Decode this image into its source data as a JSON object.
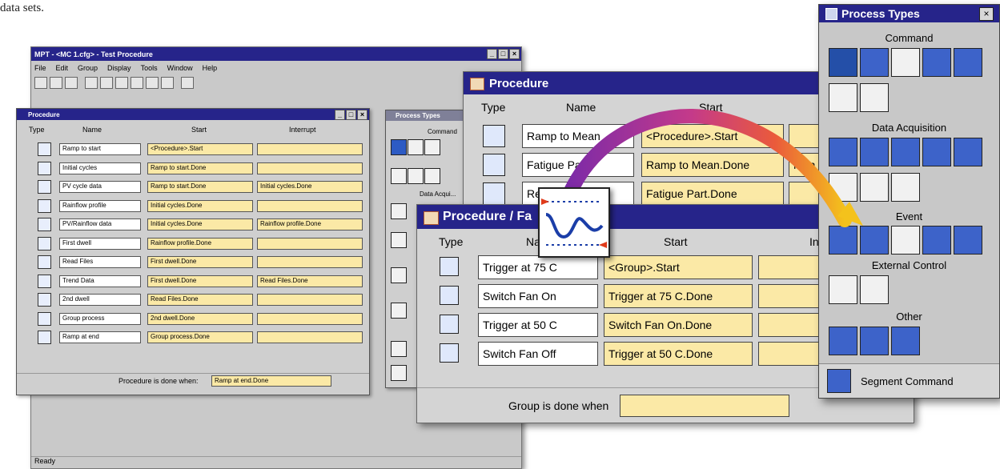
{
  "caption": "data sets.",
  "main_window": {
    "title": "MPT - <MC 1.cfg> - Test Procedure",
    "menu": [
      "File",
      "Edit",
      "Group",
      "Display",
      "Tools",
      "Window",
      "Help"
    ],
    "status": "Ready"
  },
  "small_procedure": {
    "title": "Procedure",
    "headers": {
      "type": "Type",
      "name": "Name",
      "start": "Start",
      "interrupt": "Interrupt"
    },
    "rows": [
      {
        "icon": "ramp-icon",
        "name": "Ramp to start",
        "start": "<Procedure>.Start",
        "interrupt": ""
      },
      {
        "icon": "cyclic-icon",
        "name": "Initial cycles",
        "start": "Ramp to start.Done",
        "interrupt": ""
      },
      {
        "icon": "data-acquisition-icon",
        "name": "PV cycle data",
        "start": "Ramp to start.Done",
        "interrupt": "Initial cycles.Done"
      },
      {
        "icon": "profile-icon",
        "name": "Rainflow profile",
        "start": "Initial cycles.Done",
        "interrupt": ""
      },
      {
        "icon": "data-acquisition-icon",
        "name": "PV/Rainflow data",
        "start": "Initial cycles.Done",
        "interrupt": "Rainflow profile.Done"
      },
      {
        "icon": "dwell-icon",
        "name": "First dwell",
        "start": "Rainflow profile.Done",
        "interrupt": ""
      },
      {
        "icon": "read-files-icon",
        "name": "Read Files",
        "start": "First dwell.Done",
        "interrupt": ""
      },
      {
        "icon": "trend-data-icon",
        "name": "Trend Data",
        "start": "First dwell.Done",
        "interrupt": "Read Files.Done"
      },
      {
        "icon": "dwell-icon",
        "name": "2nd dwell",
        "start": "Read Files.Done",
        "interrupt": ""
      },
      {
        "icon": "group-icon",
        "name": "Group process",
        "start": "2nd dwell.Done",
        "interrupt": ""
      },
      {
        "icon": "ramp-icon",
        "name": "Ramp at end",
        "start": "Group process.Done",
        "interrupt": ""
      }
    ],
    "done_label": "Procedure is done when:",
    "done_value": "Ramp at end.Done"
  },
  "small_process_types": {
    "title": "Process Types",
    "command": "Command",
    "data_acquisition": "Data Acqui..."
  },
  "procedure_window": {
    "title": "Procedure",
    "headers": {
      "type": "Type",
      "name": "Name",
      "start": "Start"
    },
    "rows": [
      {
        "icon": "ramp-icon",
        "name": "Ramp to Mean",
        "start": "<Procedure>.Start",
        "extra": ""
      },
      {
        "icon": "cyclic-icon",
        "name": "Fatigue Pa",
        "start": "Ramp to Mean.Done",
        "extra": "Mon"
      },
      {
        "icon": "ramp-icon",
        "name": "Ret",
        "start": "Fatigue Part.Done",
        "extra": ""
      }
    ]
  },
  "group_window": {
    "title": "Procedure / Fa",
    "headers": {
      "type": "Type",
      "name": "Na",
      "start": "Start",
      "interrupt": "In"
    },
    "rows": [
      {
        "icon": "event-trigger-icon",
        "name": "Trigger at 75 C",
        "start": "<Group>.Start"
      },
      {
        "icon": "external-control-icon",
        "name": "Switch Fan On",
        "start": "Trigger at 75 C.Done"
      },
      {
        "icon": "event-trigger-icon",
        "name": "Trigger at 50 C",
        "start": "Switch Fan On.Done"
      },
      {
        "icon": "external-control-icon",
        "name": "Switch Fan Off",
        "start": "Trigger at 50 C.Done"
      }
    ],
    "done_label": "Group is done when"
  },
  "palette": {
    "title": "Process Types",
    "sections": {
      "command": "Command",
      "data_acquisition": "Data Acquisition",
      "event": "Event",
      "external_control": "External Control",
      "other": "Other"
    },
    "footer": "Segment Command"
  },
  "colors": {
    "title_bar": "#26248a",
    "start_field": "#fbe9a6",
    "accent_arc": "#9a2fb8",
    "arc_end": "#f2b21c"
  }
}
